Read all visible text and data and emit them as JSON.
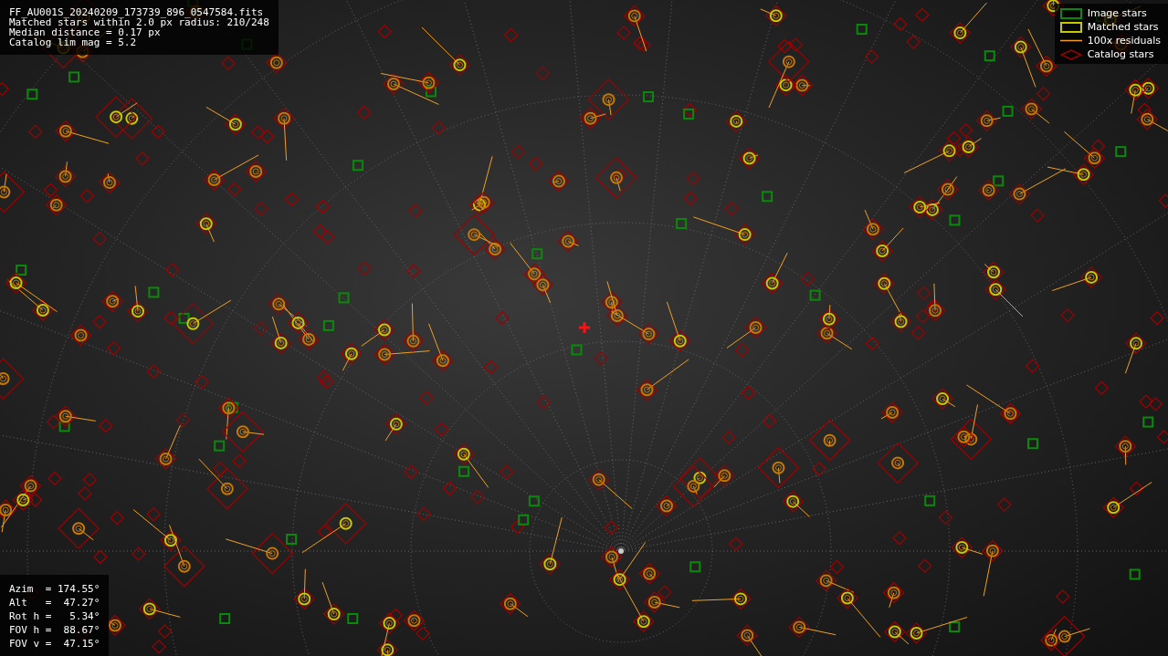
{
  "info": {
    "lines": [
      "FF_AU001S_20240209_173739_896_0547584.fits",
      "Matched stars within 2.0 px radius: 210/248",
      "Median distance = 0.17 px",
      "Catalog lim mag = 5.2"
    ]
  },
  "legend": [
    {
      "kind": "image",
      "label": "Image stars"
    },
    {
      "kind": "matched",
      "label": "Matched stars"
    },
    {
      "kind": "residual",
      "label": "100x residuals"
    },
    {
      "kind": "catalog",
      "label": "Catalog stars"
    }
  ],
  "pointing": {
    "lines": [
      "Azim  = 174.55°",
      "Alt   =  47.27°",
      "Rot h =   5.34°",
      "FOV h =  88.67°",
      "FOV v =  47.15°"
    ]
  }
}
